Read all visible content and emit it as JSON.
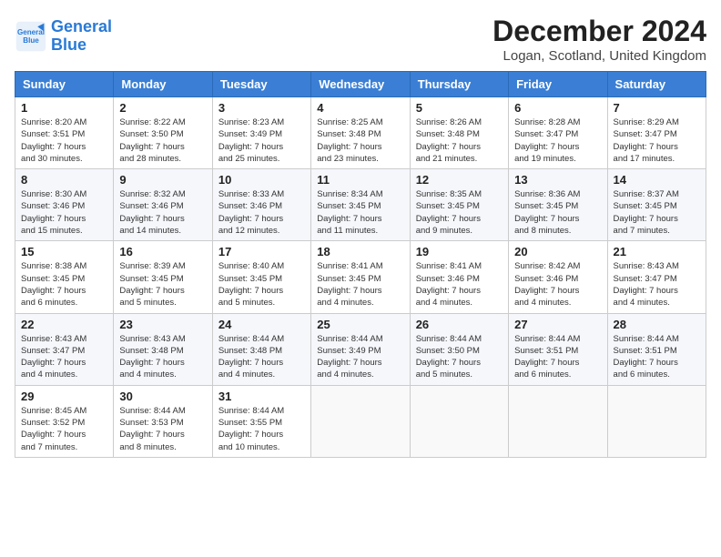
{
  "header": {
    "logo_line1": "General",
    "logo_line2": "Blue",
    "month_year": "December 2024",
    "location": "Logan, Scotland, United Kingdom"
  },
  "weekdays": [
    "Sunday",
    "Monday",
    "Tuesday",
    "Wednesday",
    "Thursday",
    "Friday",
    "Saturday"
  ],
  "weeks": [
    [
      {
        "day": "1",
        "sunrise": "8:20 AM",
        "sunset": "3:51 PM",
        "daylight": "7 hours and 30 minutes."
      },
      {
        "day": "2",
        "sunrise": "8:22 AM",
        "sunset": "3:50 PM",
        "daylight": "7 hours and 28 minutes."
      },
      {
        "day": "3",
        "sunrise": "8:23 AM",
        "sunset": "3:49 PM",
        "daylight": "7 hours and 25 minutes."
      },
      {
        "day": "4",
        "sunrise": "8:25 AM",
        "sunset": "3:48 PM",
        "daylight": "7 hours and 23 minutes."
      },
      {
        "day": "5",
        "sunrise": "8:26 AM",
        "sunset": "3:48 PM",
        "daylight": "7 hours and 21 minutes."
      },
      {
        "day": "6",
        "sunrise": "8:28 AM",
        "sunset": "3:47 PM",
        "daylight": "7 hours and 19 minutes."
      },
      {
        "day": "7",
        "sunrise": "8:29 AM",
        "sunset": "3:47 PM",
        "daylight": "7 hours and 17 minutes."
      }
    ],
    [
      {
        "day": "8",
        "sunrise": "8:30 AM",
        "sunset": "3:46 PM",
        "daylight": "7 hours and 15 minutes."
      },
      {
        "day": "9",
        "sunrise": "8:32 AM",
        "sunset": "3:46 PM",
        "daylight": "7 hours and 14 minutes."
      },
      {
        "day": "10",
        "sunrise": "8:33 AM",
        "sunset": "3:46 PM",
        "daylight": "7 hours and 12 minutes."
      },
      {
        "day": "11",
        "sunrise": "8:34 AM",
        "sunset": "3:45 PM",
        "daylight": "7 hours and 11 minutes."
      },
      {
        "day": "12",
        "sunrise": "8:35 AM",
        "sunset": "3:45 PM",
        "daylight": "7 hours and 9 minutes."
      },
      {
        "day": "13",
        "sunrise": "8:36 AM",
        "sunset": "3:45 PM",
        "daylight": "7 hours and 8 minutes."
      },
      {
        "day": "14",
        "sunrise": "8:37 AM",
        "sunset": "3:45 PM",
        "daylight": "7 hours and 7 minutes."
      }
    ],
    [
      {
        "day": "15",
        "sunrise": "8:38 AM",
        "sunset": "3:45 PM",
        "daylight": "7 hours and 6 minutes."
      },
      {
        "day": "16",
        "sunrise": "8:39 AM",
        "sunset": "3:45 PM",
        "daylight": "7 hours and 5 minutes."
      },
      {
        "day": "17",
        "sunrise": "8:40 AM",
        "sunset": "3:45 PM",
        "daylight": "7 hours and 5 minutes."
      },
      {
        "day": "18",
        "sunrise": "8:41 AM",
        "sunset": "3:45 PM",
        "daylight": "7 hours and 4 minutes."
      },
      {
        "day": "19",
        "sunrise": "8:41 AM",
        "sunset": "3:46 PM",
        "daylight": "7 hours and 4 minutes."
      },
      {
        "day": "20",
        "sunrise": "8:42 AM",
        "sunset": "3:46 PM",
        "daylight": "7 hours and 4 minutes."
      },
      {
        "day": "21",
        "sunrise": "8:43 AM",
        "sunset": "3:47 PM",
        "daylight": "7 hours and 4 minutes."
      }
    ],
    [
      {
        "day": "22",
        "sunrise": "8:43 AM",
        "sunset": "3:47 PM",
        "daylight": "7 hours and 4 minutes."
      },
      {
        "day": "23",
        "sunrise": "8:43 AM",
        "sunset": "3:48 PM",
        "daylight": "7 hours and 4 minutes."
      },
      {
        "day": "24",
        "sunrise": "8:44 AM",
        "sunset": "3:48 PM",
        "daylight": "7 hours and 4 minutes."
      },
      {
        "day": "25",
        "sunrise": "8:44 AM",
        "sunset": "3:49 PM",
        "daylight": "7 hours and 4 minutes."
      },
      {
        "day": "26",
        "sunrise": "8:44 AM",
        "sunset": "3:50 PM",
        "daylight": "7 hours and 5 minutes."
      },
      {
        "day": "27",
        "sunrise": "8:44 AM",
        "sunset": "3:51 PM",
        "daylight": "7 hours and 6 minutes."
      },
      {
        "day": "28",
        "sunrise": "8:44 AM",
        "sunset": "3:51 PM",
        "daylight": "7 hours and 6 minutes."
      }
    ],
    [
      {
        "day": "29",
        "sunrise": "8:45 AM",
        "sunset": "3:52 PM",
        "daylight": "7 hours and 7 minutes."
      },
      {
        "day": "30",
        "sunrise": "8:44 AM",
        "sunset": "3:53 PM",
        "daylight": "7 hours and 8 minutes."
      },
      {
        "day": "31",
        "sunrise": "8:44 AM",
        "sunset": "3:55 PM",
        "daylight": "7 hours and 10 minutes."
      },
      null,
      null,
      null,
      null
    ]
  ]
}
